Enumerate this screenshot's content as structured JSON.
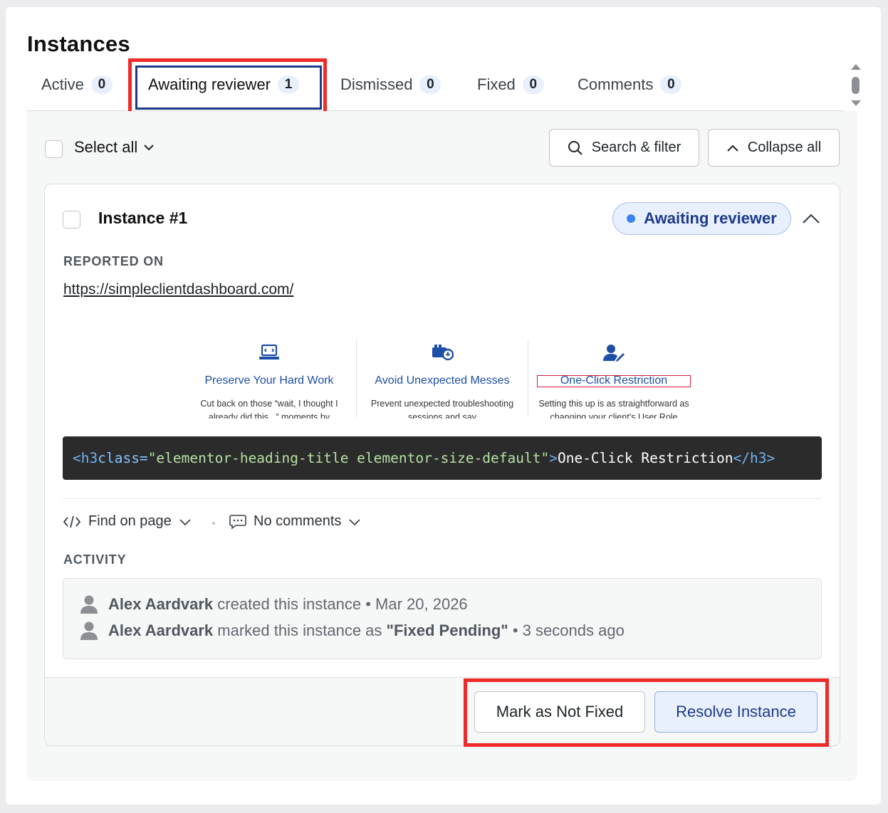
{
  "header": {
    "title": "Instances"
  },
  "tabs": [
    {
      "label": "Active",
      "count": "0"
    },
    {
      "label": "Awaiting reviewer",
      "count": "1"
    },
    {
      "label": "Dismissed",
      "count": "0"
    },
    {
      "label": "Fixed",
      "count": "0"
    },
    {
      "label": "Comments",
      "count": "0"
    }
  ],
  "toolbar": {
    "select_all": "Select all",
    "search_filter": "Search & filter",
    "collapse_all": "Collapse all"
  },
  "instance": {
    "title": "Instance #1",
    "status": "Awaiting reviewer",
    "reported_on_label": "REPORTED ON",
    "url": "https://simpleclientdashboard.com/",
    "preview": {
      "col1_title": "Preserve Your Hard Work",
      "col1_desc": "Cut back on those “wait, I thought I already did this...” moments by",
      "col2_title": "Avoid Unexpected Messes",
      "col2_desc": "Prevent unexpected troubleshooting sessions and say",
      "col3_title": "One-Click Restriction",
      "col3_desc": "Setting this up is as straightforward as changing your client’s User Role"
    },
    "code": {
      "open_tag": "<h3",
      "attr": " class=",
      "value": "\"elementor-heading-title elementor-size-default\"",
      "close_bracket": ">",
      "text": "One-Click Restriction",
      "end_tag": "</h3>"
    },
    "find_on_page": "Find on page",
    "comments_label": "No comments",
    "activity_label": "ACTIVITY",
    "activity": [
      {
        "user": "Alex Aardvark",
        "action": "created this instance",
        "sep": "•",
        "time": "Mar 20, 2026"
      },
      {
        "user": "Alex Aardvark",
        "action": "marked this instance as",
        "status": "\"Fixed Pending\"",
        "sep": "•",
        "time": "3 seconds ago"
      }
    ],
    "buttons": {
      "not_fixed": "Mark as Not Fixed",
      "resolve": "Resolve Instance"
    }
  },
  "colors": {
    "accent": "#1e3a8a",
    "highlight": "#ee2b2b",
    "badge_bg": "#e8f0fe"
  }
}
